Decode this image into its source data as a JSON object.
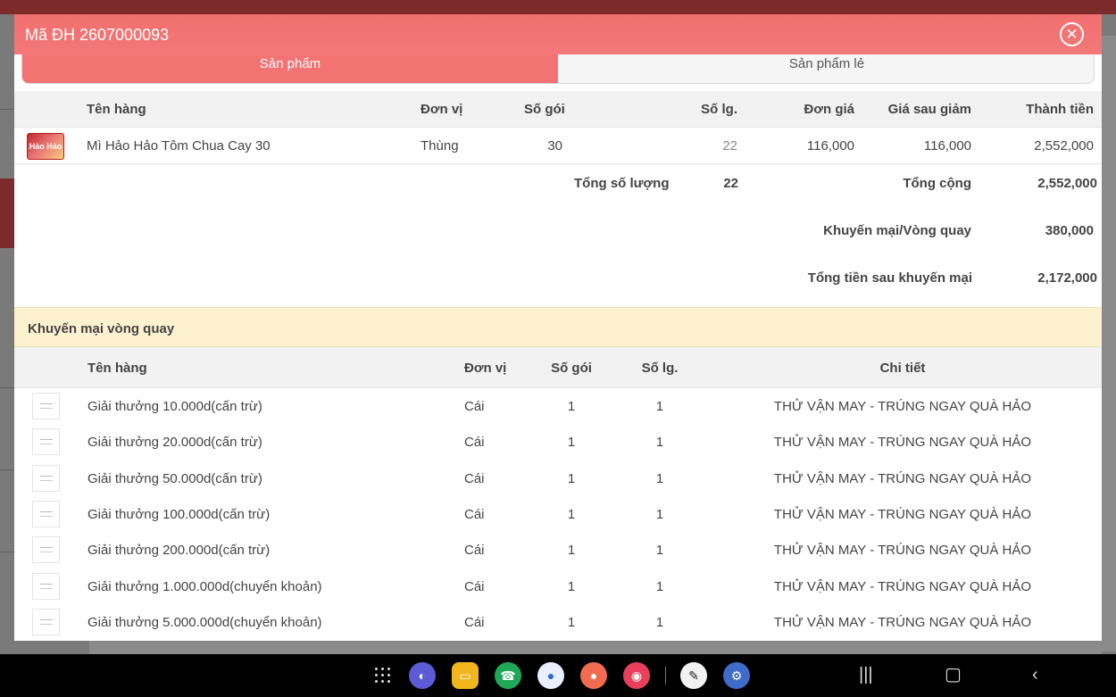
{
  "modal": {
    "title": "Mã ĐH 2607000093",
    "close_icon": "close-circle-icon"
  },
  "tabs": [
    {
      "label": "Sản phẩm",
      "active": true
    },
    {
      "label": "Sản phẩm lẻ",
      "active": false
    }
  ],
  "products": {
    "headers": {
      "name": "Tên hàng",
      "unit": "Đơn vị",
      "packs": "Số gói",
      "qty": "Số lg.",
      "price": "Đơn giá",
      "discounted": "Giá sau giảm",
      "total": "Thành tiền"
    },
    "rows": [
      {
        "image_text": "Hảo Hảo",
        "name": "Mì Hảo Hảo Tôm Chua Cay 30",
        "unit": "Thùng",
        "packs": "30",
        "qty": "22",
        "price": "116,000",
        "discounted": "116,000",
        "total": "2,552,000"
      }
    ]
  },
  "summary": {
    "total_qty_label": "Tổng số lượng",
    "total_qty": "22",
    "grand_total_label": "Tổng cộng",
    "grand_total": "2,552,000",
    "promo_label": "Khuyến mại/Vòng quay",
    "promo_value": "380,000",
    "after_promo_label": "Tổng tiền sau khuyến mại",
    "after_promo_value": "2,172,000"
  },
  "promotion": {
    "section_title": "Khuyến mại vòng quay",
    "headers": {
      "name": "Tên hàng",
      "unit": "Đơn vị",
      "packs": "Số gói",
      "qty": "Số lg.",
      "detail": "Chi tiết"
    },
    "rows": [
      {
        "name": "Giải thưởng 10.000d(cấn trừ)",
        "unit": "Cái",
        "packs": "1",
        "qty": "1",
        "detail": "THỬ VẬN MAY - TRÚNG NGAY QUÀ HẢO"
      },
      {
        "name": "Giải thưởng 20.000d(cấn trừ)",
        "unit": "Cái",
        "packs": "1",
        "qty": "1",
        "detail": "THỬ VẬN MAY - TRÚNG NGAY QUÀ HẢO"
      },
      {
        "name": "Giải thưởng 50.000d(cấn trừ)",
        "unit": "Cái",
        "packs": "1",
        "qty": "1",
        "detail": "THỬ VẬN MAY - TRÚNG NGAY QUÀ HẢO"
      },
      {
        "name": "Giải thưởng 100.000d(cấn trừ)",
        "unit": "Cái",
        "packs": "1",
        "qty": "1",
        "detail": "THỬ VẬN MAY - TRÚNG NGAY QUÀ HẢO"
      },
      {
        "name": "Giải thưởng 200.000d(cấn trừ)",
        "unit": "Cái",
        "packs": "1",
        "qty": "1",
        "detail": "THỬ VẬN MAY - TRÚNG NGAY QUÀ HẢO"
      },
      {
        "name": "Giải thưởng 1.000.000d(chuyển khoản)",
        "unit": "Cái",
        "packs": "1",
        "qty": "1",
        "detail": "THỬ VẬN MAY - TRÚNG NGAY QUÀ HẢO"
      },
      {
        "name": "Giải thưởng 5.000.000d(chuyển khoản)",
        "unit": "Cái",
        "packs": "1",
        "qty": "1",
        "detail": "THỬ VẬN MAY - TRÚNG NGAY QUÀ HẢO"
      }
    ]
  },
  "navbar": {
    "dock": [
      {
        "icon": "apps-grid-icon"
      },
      {
        "icon": "internet-browser-icon",
        "color": "#5b5bd6"
      },
      {
        "icon": "my-files-icon",
        "color": "#f2b51d"
      },
      {
        "icon": "phone-icon",
        "color": "#1fa855"
      },
      {
        "icon": "messages-icon",
        "color": "#e8f0ff"
      },
      {
        "icon": "contacts-icon",
        "color": "#f06b4f"
      },
      {
        "icon": "screen-recorder-icon",
        "color": "#e8405a"
      },
      {
        "icon": "notes-app-icon",
        "color": "#f2f2f2"
      },
      {
        "icon": "settings-icon",
        "color": "#3f6cc9"
      }
    ],
    "system": [
      "recent-apps-icon",
      "home-icon",
      "back-icon"
    ]
  },
  "colors": {
    "accent": "#f37373",
    "promo_bg": "#fdf1cf",
    "header_bg": "#f2f2f2"
  }
}
